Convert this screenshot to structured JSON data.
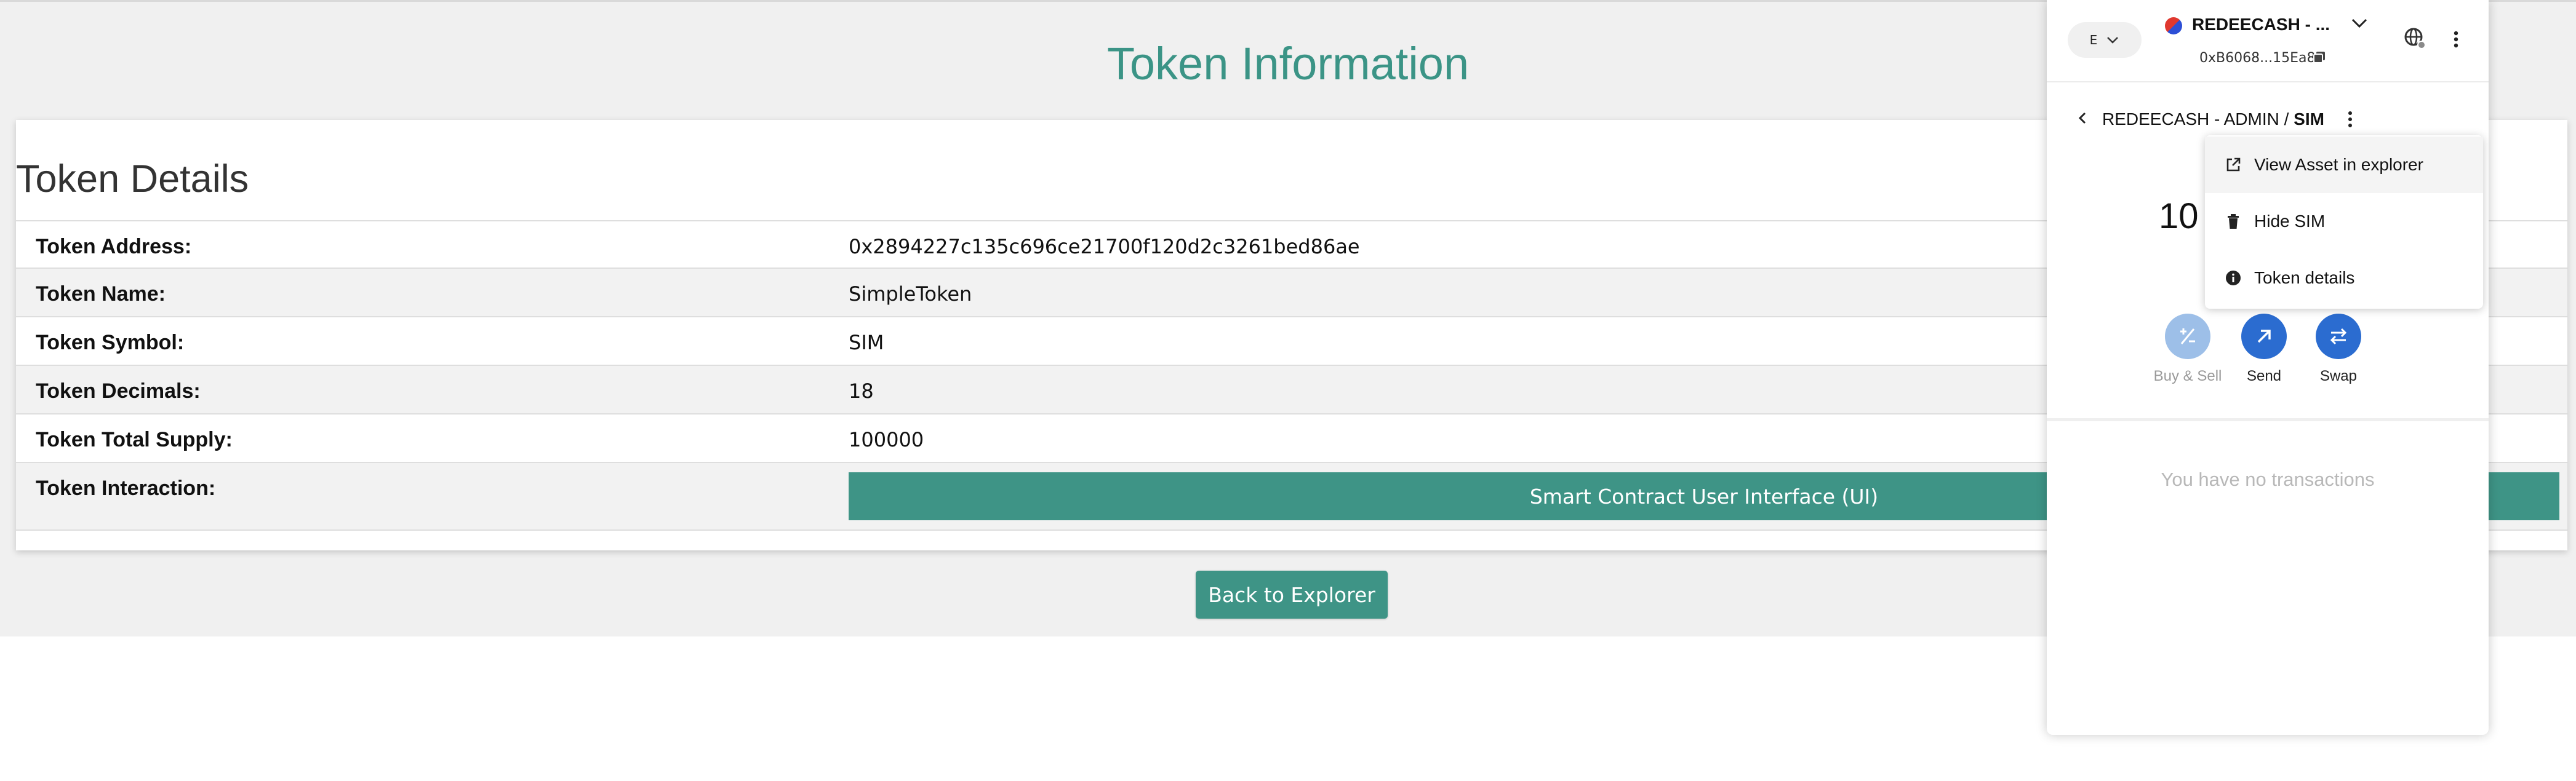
{
  "page": {
    "title": "Token Information",
    "card_heading": "Token Details",
    "rows": [
      {
        "label": "Token Address:",
        "value": "0x2894227c135c696ce21700f120d2c3261bed86ae"
      },
      {
        "label": "Token Name:",
        "value": "SimpleToken"
      },
      {
        "label": "Token Symbol:",
        "value": "SIM"
      },
      {
        "label": "Token Decimals:",
        "value": "18"
      },
      {
        "label": "Token Total Supply:",
        "value": "100000"
      }
    ],
    "interaction_label": "Token Interaction:",
    "ui_button": "Smart Contract User Interface (UI)",
    "back_button": "Back to Explorer",
    "accent_color": "#3e9486"
  },
  "wallet": {
    "network_initial": "E",
    "account_name": "REDEECASH - ...",
    "account_address": "0xB6068...15Ea8",
    "breadcrumb_prefix": "REDEECASH - ADMIN / ",
    "breadcrumb_token": "SIM",
    "balance_partial": "10",
    "actions": [
      {
        "label": "Buy & Sell",
        "icon": "plus-minus-icon",
        "disabled": true
      },
      {
        "label": "Send",
        "icon": "arrow-up-right-icon",
        "disabled": false
      },
      {
        "label": "Swap",
        "icon": "swap-arrows-icon",
        "disabled": false
      }
    ],
    "empty_state": "You have no transactions",
    "menu": [
      {
        "label": "View Asset in explorer",
        "icon": "external-link-icon"
      },
      {
        "label": "Hide SIM",
        "icon": "trash-icon"
      },
      {
        "label": "Token details",
        "icon": "info-icon"
      }
    ],
    "primary_color": "#2b6cd0"
  }
}
